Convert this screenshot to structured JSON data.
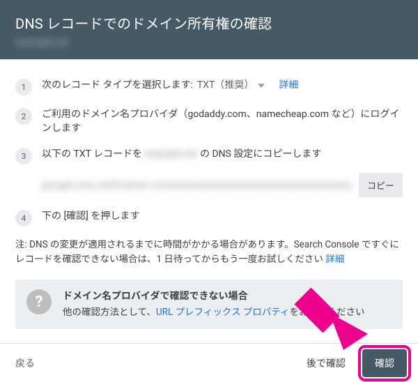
{
  "header": {
    "title": "DNS レコードでのドメイン所有権の確認",
    "subtitle_blurred": "example.set"
  },
  "steps": {
    "s1": {
      "num": "1",
      "prefix": "次のレコード タイプを選択します:",
      "value": "TXT（推奨）",
      "detail": "詳細"
    },
    "s2": {
      "num": "2",
      "text": "ご利用のドメイン名プロバイダ（godaddy.com、namecheap.com など）にログインします"
    },
    "s3": {
      "num": "3",
      "before": "以下の TXT レコードを ",
      "blurred": "example.set",
      "after": " の DNS 設定にコピーします"
    },
    "record_blurred": "google-site-verification=xxxxxxxxxxxxxxxxxxxxxxxxxxxxxxxxxxxxxxxxxxx",
    "copy": "コピー",
    "s4": {
      "num": "4",
      "text": "下の [確認] を押します"
    }
  },
  "note": {
    "text": "注: DNS の変更が適用されるまでに時間がかかる場合があります。Search Console ですぐにレコードを確認できない場合は、1 日待ってからもう一度お試しください ",
    "link": "詳細"
  },
  "info": {
    "icon": "?",
    "title": "ドメイン名プロバイダで確認できない場合",
    "before": "他の確認方法として、",
    "link": "URL プレフィックス プロパティ",
    "after": "をお試しください"
  },
  "footer": {
    "back": "戻る",
    "later": "後で確認",
    "confirm": "確認"
  }
}
